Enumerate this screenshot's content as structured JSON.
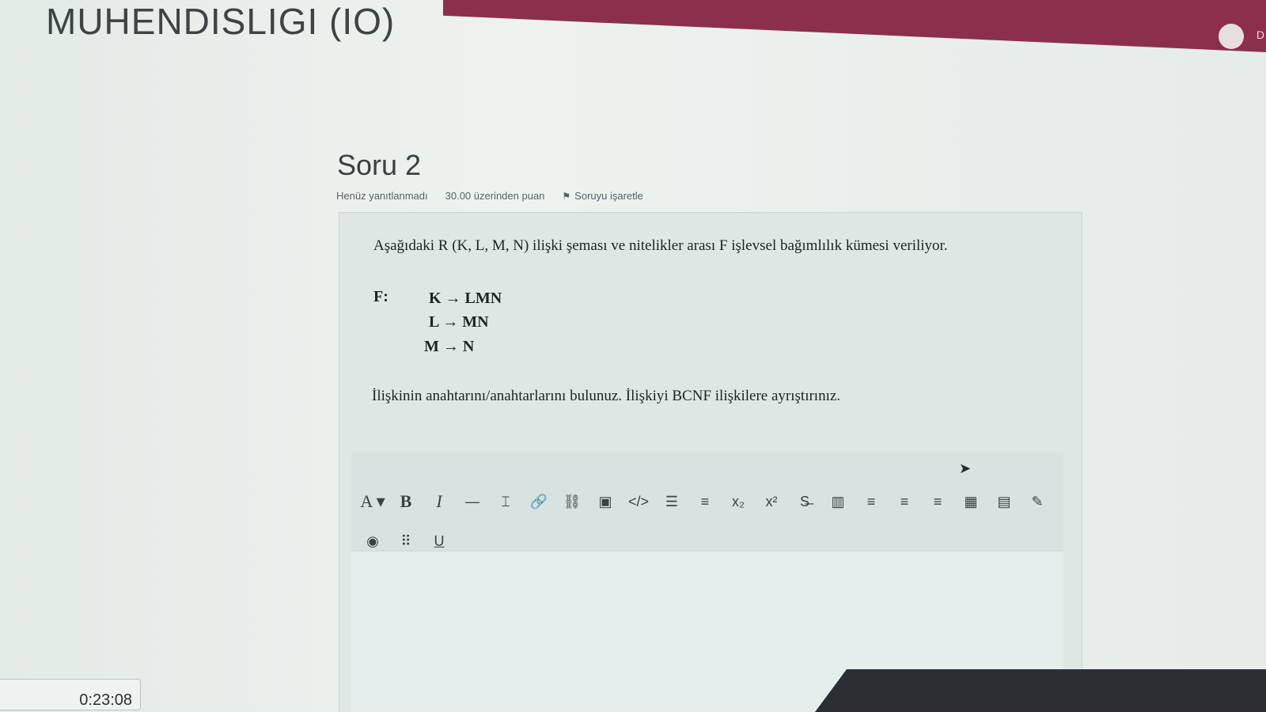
{
  "header": {
    "course_title": "MUHENDISLIGI (IO)",
    "user_initial": "D"
  },
  "question": {
    "heading": "Soru 2",
    "status": "Henüz yanıtlanmadı",
    "points": "30.00 üzerinden puan",
    "flag_label": "Soruyu işaretle",
    "intro_text": "Aşağıdaki R (K, L, M, N) ilişki şeması ve nitelikler arası F işlevsel bağımlılık kümesi veriliyor.",
    "fd_label": "F:",
    "fds": [
      "K → LMN",
      "L → MN",
      "M → N"
    ],
    "instruction": "İlişkinin anahtarını/anahtarlarını bulunuz. İlişkiyi BCNF ilişkilere ayrıştırınız."
  },
  "toolbar": {
    "row1": [
      {
        "name": "font-size-icon",
        "glyph": "A ▾"
      },
      {
        "name": "bold-icon",
        "glyph": "B"
      },
      {
        "name": "italic-icon",
        "glyph": "I"
      },
      {
        "name": "horizontal-rule-icon",
        "glyph": "—"
      },
      {
        "name": "text-cursor-icon",
        "glyph": "⌶"
      },
      {
        "name": "link-icon",
        "glyph": "🔗"
      },
      {
        "name": "unlink-icon",
        "glyph": "⛓"
      },
      {
        "name": "image-icon",
        "glyph": "▣"
      },
      {
        "name": "code-icon",
        "glyph": "</>"
      },
      {
        "name": "bullet-list-icon",
        "glyph": "☰"
      },
      {
        "name": "numbered-list-icon",
        "glyph": "≡"
      },
      {
        "name": "subscript-icon",
        "glyph": "x₂"
      },
      {
        "name": "superscript-icon",
        "glyph": "x²"
      },
      {
        "name": "strikethrough-icon",
        "glyph": "S̶"
      },
      {
        "name": "column-icon",
        "glyph": "▥"
      },
      {
        "name": "align-left-icon",
        "glyph": "≡"
      },
      {
        "name": "align-center-icon",
        "glyph": "≡"
      },
      {
        "name": "align-right-icon",
        "glyph": "≡"
      },
      {
        "name": "table-icon",
        "glyph": "▦"
      },
      {
        "name": "calculator-icon",
        "glyph": "▤"
      },
      {
        "name": "edit-icon",
        "glyph": "✎"
      }
    ],
    "row2": [
      {
        "name": "accessibility-icon",
        "glyph": "◉"
      },
      {
        "name": "dots-icon",
        "glyph": "⠿"
      },
      {
        "name": "underline-icon",
        "glyph": "U"
      }
    ]
  },
  "timer": {
    "value": "0:23:08"
  },
  "colors": {
    "header_strip": "#8c2f4d",
    "background": "#e7eeeb"
  }
}
